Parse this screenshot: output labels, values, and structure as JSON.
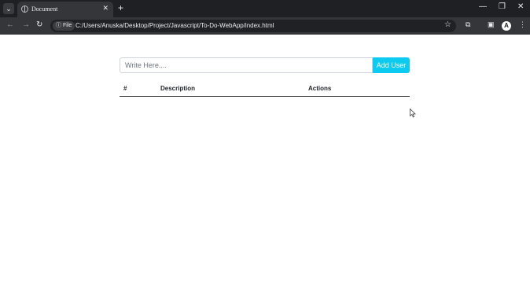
{
  "browser": {
    "tab_title": "Document",
    "file_chip": "File",
    "url": "C:/Users/Anuska/Desktop/Project/Javascript/To-Do-WebApp/index.html",
    "avatar_letter": "A"
  },
  "form": {
    "placeholder": "Write Here....",
    "value": "",
    "add_button": "Add User"
  },
  "table": {
    "headers": [
      "#",
      "Description",
      "Actions"
    ],
    "rows": []
  },
  "colors": {
    "accent": "#0dcaf0"
  }
}
